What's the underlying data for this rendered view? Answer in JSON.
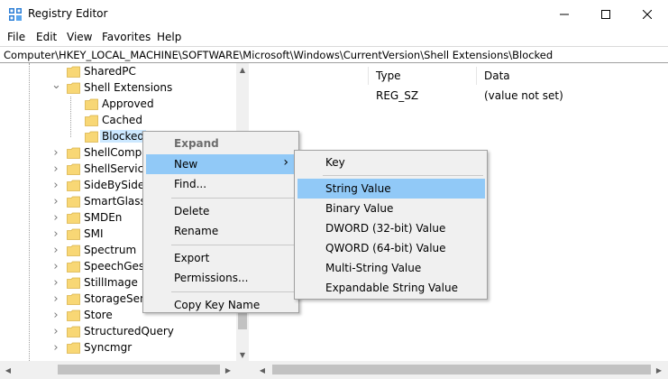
{
  "window": {
    "title": "Registry Editor",
    "icon": "registry-icon",
    "controls": [
      "minimize-icon",
      "maximize-icon",
      "close-icon"
    ]
  },
  "menubar": {
    "items": [
      "File",
      "Edit",
      "View",
      "Favorites",
      "Help"
    ]
  },
  "address": {
    "path": "Computer\\HKEY_LOCAL_MACHINE\\SOFTWARE\\Microsoft\\Windows\\CurrentVersion\\Shell Extensions\\Blocked"
  },
  "tree": {
    "items": [
      {
        "label": "SharedPC",
        "expander": "",
        "level": 1
      },
      {
        "label": "Shell Extensions",
        "expander": "expanded",
        "level": 1
      },
      {
        "label": "Approved",
        "expander": "",
        "level": 2
      },
      {
        "label": "Cached",
        "expander": "",
        "level": 2
      },
      {
        "label": "Blocked",
        "expander": "",
        "level": 2,
        "selected": true
      },
      {
        "label": "ShellCompa",
        "expander": "collapsed",
        "level": 1
      },
      {
        "label": "ShellService",
        "expander": "collapsed",
        "level": 1
      },
      {
        "label": "SideBySide",
        "expander": "collapsed",
        "level": 1
      },
      {
        "label": "SmartGlass",
        "expander": "collapsed",
        "level": 1
      },
      {
        "label": "SMDEn",
        "expander": "collapsed",
        "level": 1
      },
      {
        "label": "SMI",
        "expander": "collapsed",
        "level": 1
      },
      {
        "label": "Spectrum",
        "expander": "collapsed",
        "level": 1
      },
      {
        "label": "SpeechGestu",
        "expander": "collapsed",
        "level": 1
      },
      {
        "label": "StillImage",
        "expander": "collapsed",
        "level": 1
      },
      {
        "label": "StorageSens",
        "expander": "collapsed",
        "level": 1
      },
      {
        "label": "Store",
        "expander": "collapsed",
        "level": 1
      },
      {
        "label": "StructuredQuery",
        "expander": "collapsed",
        "level": 1
      },
      {
        "label": "Syncmgr",
        "expander": "collapsed",
        "level": 1
      }
    ]
  },
  "list": {
    "columns": [
      "Type",
      "Data"
    ],
    "rows": [
      {
        "type": "REG_SZ",
        "data": "(value not set)"
      }
    ]
  },
  "context_menu": {
    "items": [
      {
        "label": "Expand",
        "bold": true
      },
      {
        "label": "New",
        "submenu": true,
        "hover": true
      },
      {
        "label": "Find..."
      },
      {
        "separator": true
      },
      {
        "label": "Delete"
      },
      {
        "label": "Rename"
      },
      {
        "separator": true
      },
      {
        "label": "Export"
      },
      {
        "label": "Permissions..."
      },
      {
        "separator": true
      },
      {
        "label": "Copy Key Name"
      }
    ]
  },
  "submenu": {
    "items": [
      {
        "label": "Key"
      },
      {
        "separator": true
      },
      {
        "label": "String Value",
        "hover": true
      },
      {
        "label": "Binary Value"
      },
      {
        "label": "DWORD (32-bit) Value"
      },
      {
        "label": "QWORD (64-bit) Value"
      },
      {
        "label": "Multi-String Value"
      },
      {
        "label": "Expandable String Value"
      }
    ]
  },
  "colors": {
    "selection": "#cce8ff",
    "menu_hover": "#91c9f7",
    "menu_bg": "#f0f0f0",
    "folder": "#f8d775"
  }
}
